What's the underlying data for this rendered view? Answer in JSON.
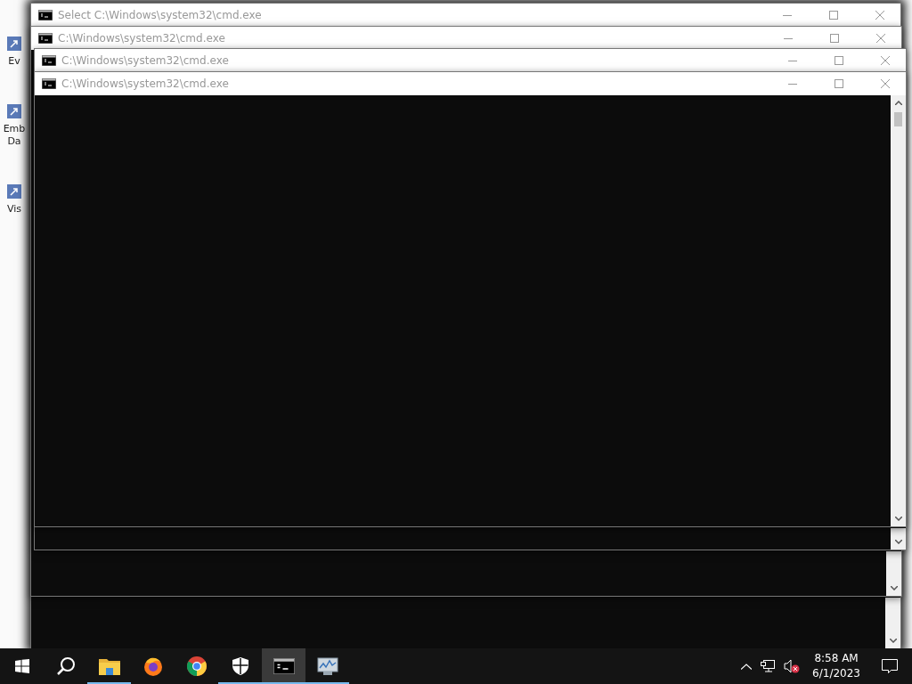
{
  "desktop_icons": [
    {
      "label": "Ev"
    },
    {
      "label": "Emb Da"
    },
    {
      "label": "Vis"
    }
  ],
  "windows": [
    {
      "title": "Select C:\\Windows\\system32\\cmd.exe",
      "active": false
    },
    {
      "title": "C:\\Windows\\system32\\cmd.exe",
      "active": false
    },
    {
      "title": "C:\\Windows\\system32\\cmd.exe",
      "active": false
    },
    {
      "title": "C:\\Windows\\system32\\cmd.exe",
      "active": false,
      "scroll_thumb": true
    }
  ],
  "taskbar": {
    "items": [
      {
        "kind": "start",
        "running": false,
        "selected": false
      },
      {
        "kind": "search",
        "running": false,
        "selected": false
      },
      {
        "kind": "folder",
        "running": true,
        "selected": false
      },
      {
        "kind": "firefox",
        "running": false,
        "selected": false
      },
      {
        "kind": "chrome",
        "running": false,
        "selected": false
      },
      {
        "kind": "shield",
        "running": true,
        "selected": false
      },
      {
        "kind": "terminal",
        "running": true,
        "selected": true
      },
      {
        "kind": "monitor",
        "running": true,
        "selected": false
      }
    ],
    "tray": {
      "time": "8:58 AM",
      "date": "6/1/2023",
      "volume_muted": true
    }
  }
}
